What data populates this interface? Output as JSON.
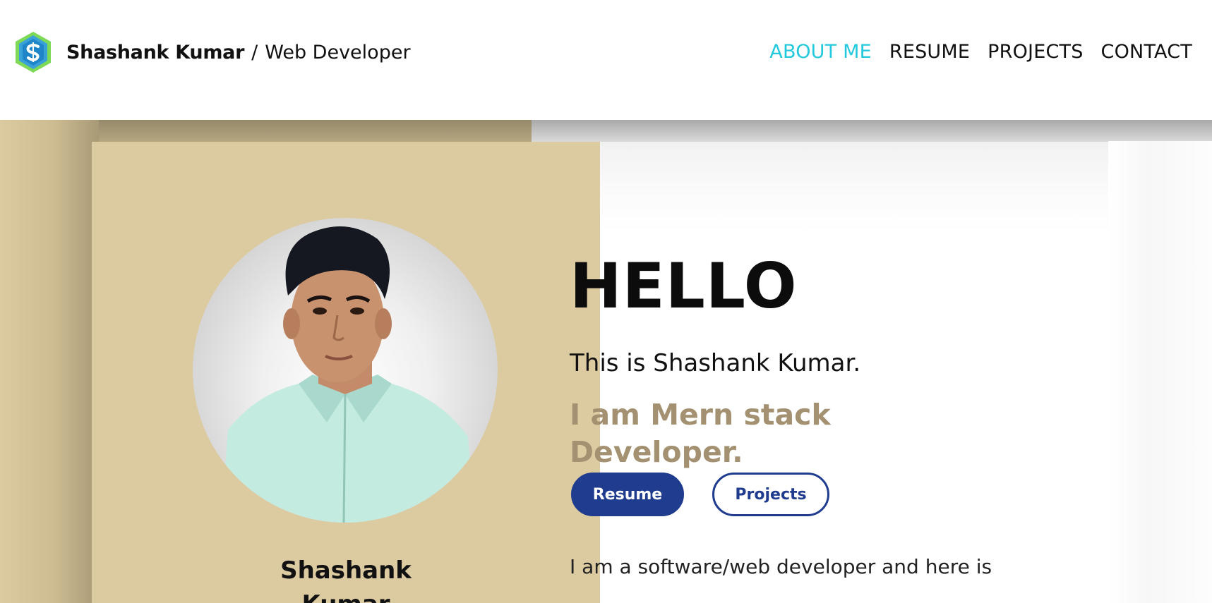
{
  "header": {
    "logo_icon": "hexagon-s-logo-icon",
    "name": "Shashank Kumar",
    "separator": "/",
    "role": "Web Developer"
  },
  "nav": {
    "items": [
      {
        "label": "ABOUT ME",
        "active": true
      },
      {
        "label": "RESUME",
        "active": false
      },
      {
        "label": "PROJECTS",
        "active": false
      },
      {
        "label": "CONTACT",
        "active": false
      }
    ],
    "active_color": "#22c8db"
  },
  "profile": {
    "photo_icon": "profile-photo",
    "name_line1": "Shashank",
    "name_line2": "Kumar"
  },
  "hero": {
    "greeting": "HELLO",
    "intro": "This is Shashank Kumar.",
    "role": "I am Mern stack Developer.",
    "resume_button": "Resume",
    "projects_button": "Projects",
    "about_text": "I am a software/web developer and here is"
  },
  "colors": {
    "tan": "#dccaa0",
    "accent_brown": "#a39171",
    "button_blue": "#1f3c8f"
  }
}
